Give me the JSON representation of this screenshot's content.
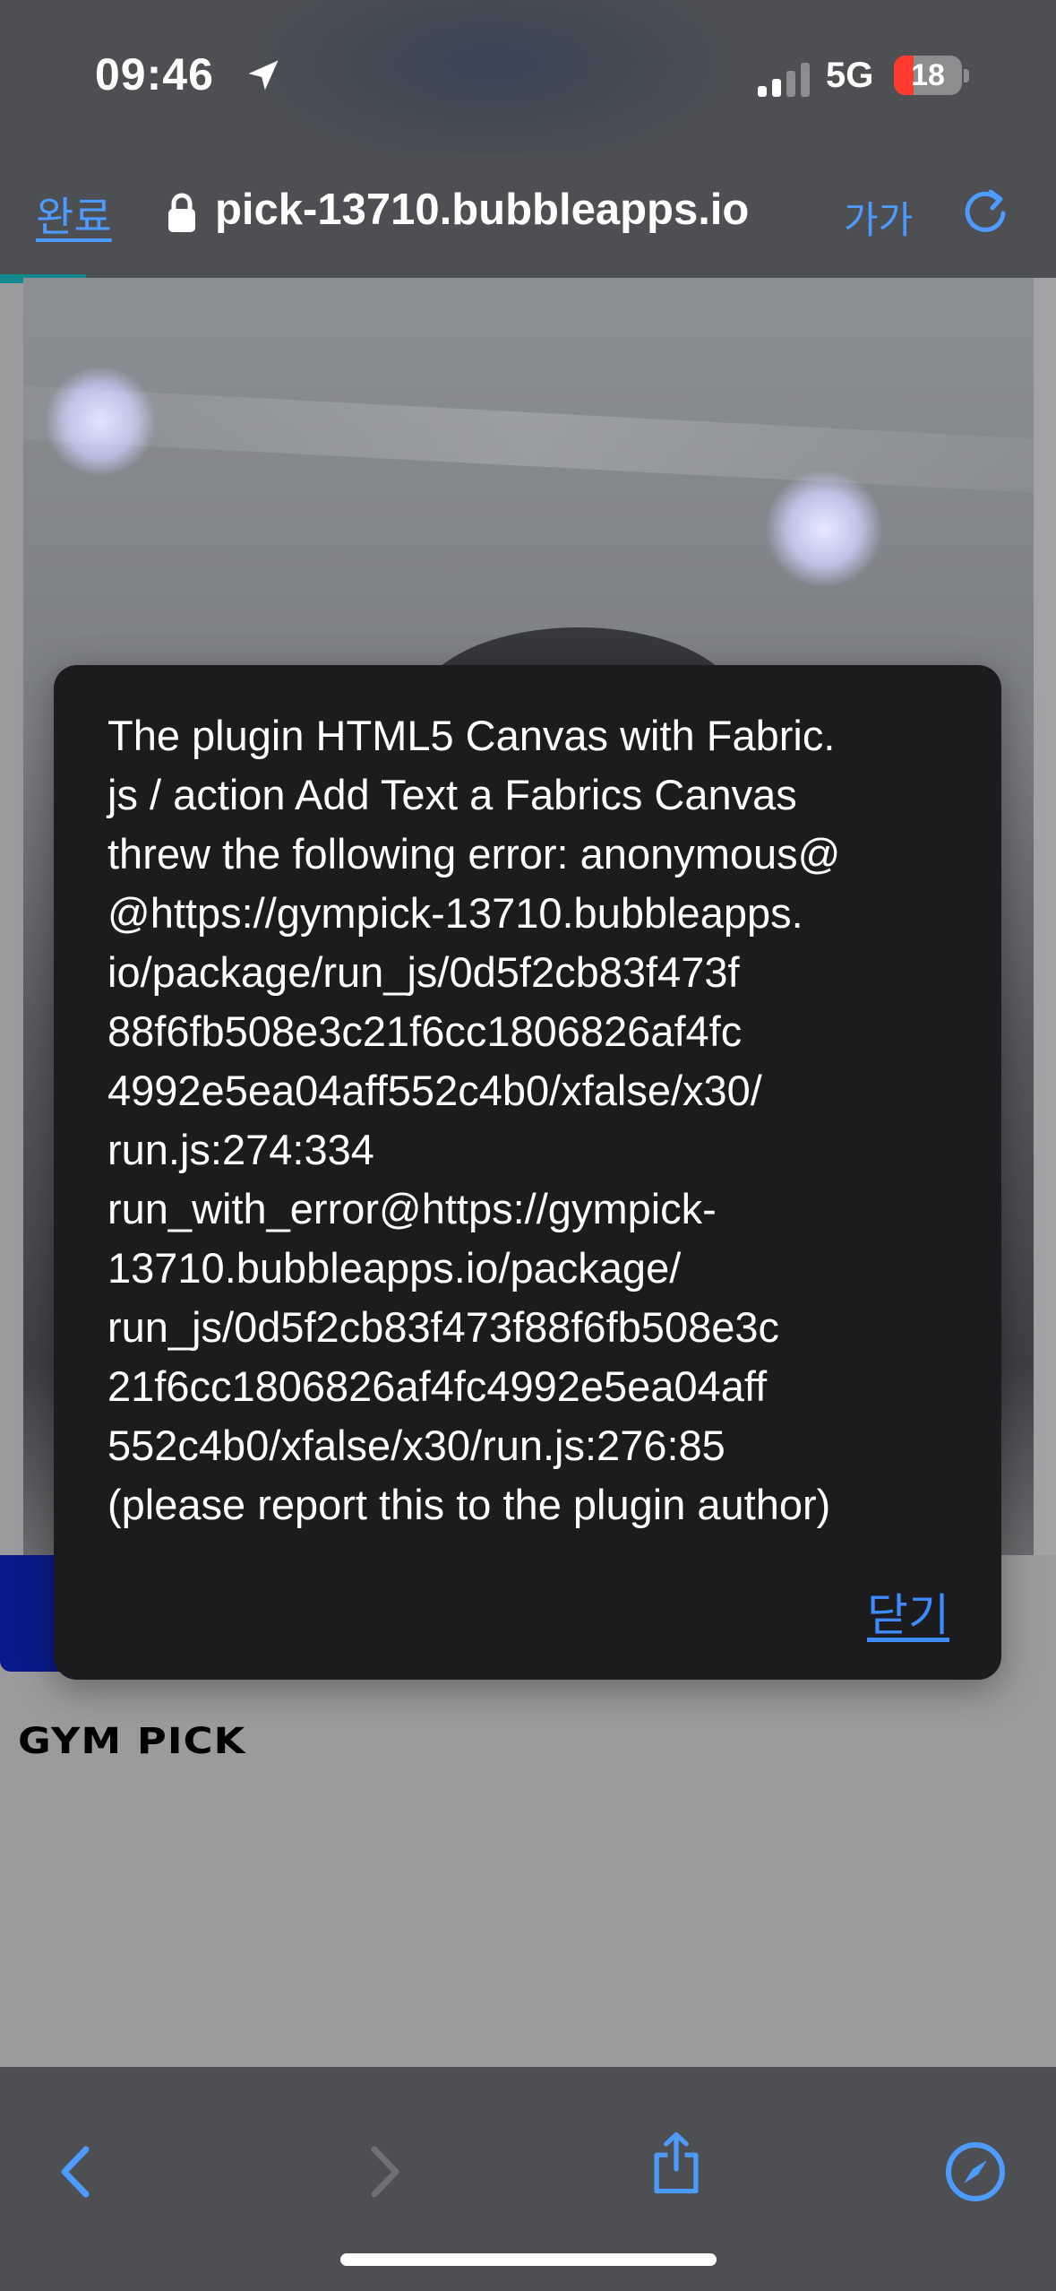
{
  "status_bar": {
    "time": "09:46",
    "network": "5G",
    "battery": "18",
    "battery_color": "#ff3b30"
  },
  "browser": {
    "done_label": "완료",
    "url": "pick-13710.bubbleapps.io",
    "text_size_label": "가가",
    "accent_color": "#4d9bff"
  },
  "page": {
    "logo_text": "GYM PICK"
  },
  "dialog": {
    "message": "The plugin HTML5 Canvas with Fabric.\njs / action Add Text a Fabrics Canvas\nthrew the following error: anonymous@\n@https://gympick-13710.bubbleapps.\nio/package/run_js/0d5f2cb83f473f\n88f6fb508e3c21f6cc1806826af4fc\n4992e5ea04aff552c4b0/xfalse/x30/\nrun.js:274:334\nrun_with_error@https://gympick-\n13710.bubbleapps.io/package/\nrun_js/0d5f2cb83f473f88f6fb508e3c\n21f6cc1806826af4fc4992e5ea04aff\n552c4b0/xfalse/x30/run.js:276:85\n(please report this to the plugin author)",
    "close_label": "닫기"
  },
  "toolbar": {
    "icons": [
      "back-icon",
      "forward-icon",
      "share-icon",
      "compass-icon"
    ]
  }
}
